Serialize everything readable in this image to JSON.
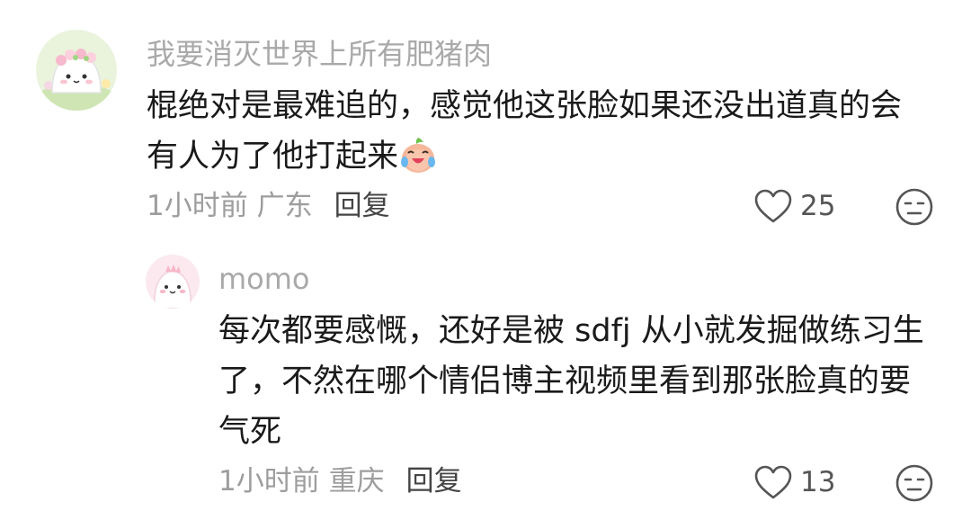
{
  "comments": [
    {
      "username": "我要消灭世界上所有肥猪肉",
      "lines": [
        "棍绝对是最难追的，感觉他这张脸如果还没出道真的会",
        "有人为了他打起来"
      ],
      "time_location": "1小时前 广东",
      "reply_label": "回复",
      "likes": "25",
      "avatar_icon": "cute-bun-flower-crown-avatar",
      "emoji_icon": "laughing-crying-emoji"
    },
    {
      "username": "momo",
      "lines": [
        "每次都要感慨，还好是被 sdfj 从小就发掘做练习生",
        "了，不然在哪个情侣博主视频里看到那张脸真的要",
        "气死"
      ],
      "time_location": "1小时前 重庆",
      "reply_label": "回复",
      "likes": "13",
      "avatar_icon": "cute-pink-dino-avatar"
    }
  ],
  "icons": {
    "like": "heart-outline-icon",
    "dislike": "meh-face-icon"
  }
}
